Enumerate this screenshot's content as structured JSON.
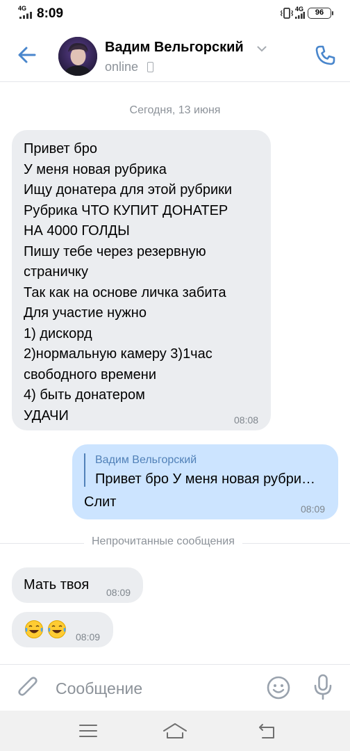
{
  "status_bar": {
    "network": "4G",
    "time": "8:09",
    "network_right": "4G",
    "battery": "96"
  },
  "header": {
    "contact_name": "Вадим Вельгорский",
    "status": "online",
    "icons": [
      "back-arrow-icon",
      "chevron-down-icon",
      "mobile-device-icon",
      "phone-icon"
    ]
  },
  "chat": {
    "date_divider": "Сегодня, 13 июня",
    "messages": [
      {
        "direction": "incoming",
        "text": "Привет бро\nУ меня новая рубрика\nИщу донатера для этой рубрики\nРубрика ЧТО КУПИТ ДОНАТЕР\nНА 4000 ГОЛДЫ\nПишу тебе через резервную\nстраничку\nТак как на основе личка забита\nДля участие нужно\n1) дискорд\n2)нормальную камеру 3)1час\nсвободного времени\n4) быть донатером\nУДАЧИ",
        "time": "08:08"
      },
      {
        "direction": "outgoing",
        "reply_author": "Вадим Вельгорский",
        "reply_text": "Привет бро  У меня новая рубри…",
        "text": "Слит",
        "time": "08:09"
      }
    ],
    "unread_divider": "Непрочитанные сообщения",
    "unread_messages": [
      {
        "direction": "incoming",
        "text": "Мать твоя",
        "time": "08:09"
      },
      {
        "direction": "incoming",
        "text": "😂😂",
        "emoji_icons": [
          "laughing-tears-emoji",
          "laughing-tears-emoji"
        ],
        "time": "08:09"
      }
    ]
  },
  "input_bar": {
    "placeholder": "Сообщение",
    "value": "",
    "icons": [
      "paperclip-icon",
      "smile-icon",
      "microphone-icon"
    ]
  },
  "nav_bar": {
    "icons": [
      "menu-icon",
      "home-icon",
      "back-icon"
    ]
  },
  "colors": {
    "accent": "#5181b8",
    "incoming_bubble": "#ebedf0",
    "outgoing_bubble": "#cce4ff",
    "secondary_text": "#8c9299"
  }
}
